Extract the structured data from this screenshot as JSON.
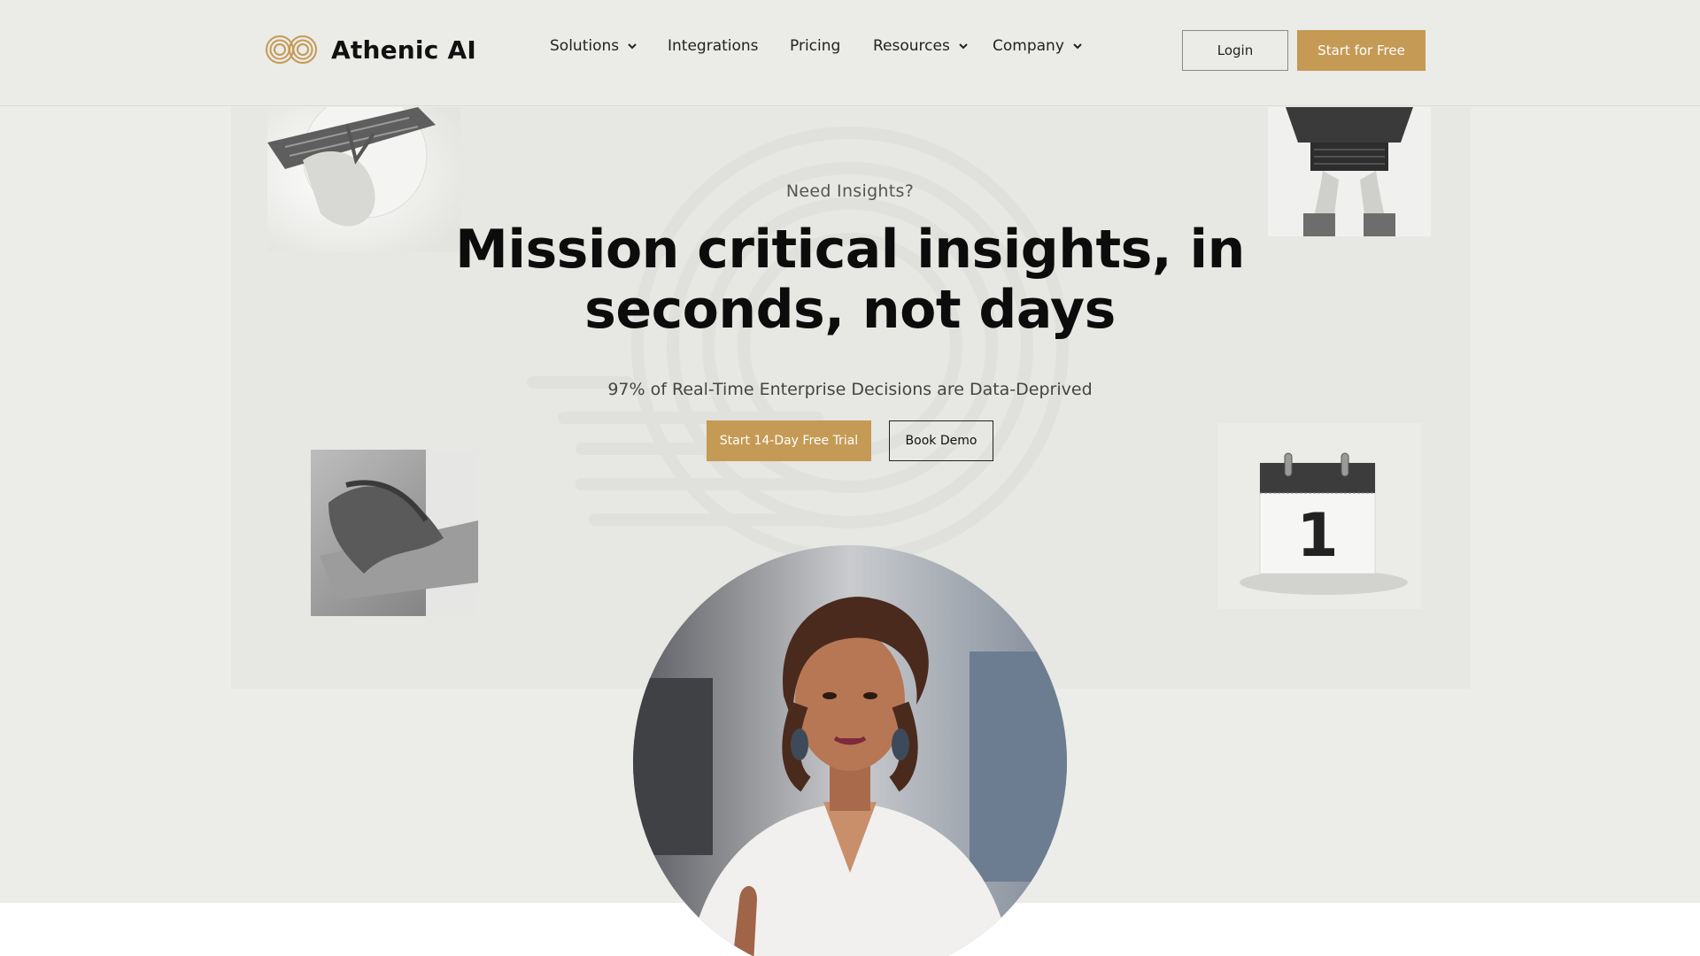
{
  "brand": {
    "name": "Athenic AI",
    "accent": "#c49a55"
  },
  "nav": {
    "items": [
      {
        "label": "Solutions",
        "has_dropdown": true
      },
      {
        "label": "Integrations",
        "has_dropdown": false
      },
      {
        "label": "Pricing",
        "has_dropdown": false
      },
      {
        "label": "Resources",
        "has_dropdown": true
      },
      {
        "label": "Company",
        "has_dropdown": true
      }
    ],
    "login_label": "Login",
    "start_label": "Start for Free"
  },
  "hero": {
    "eyebrow": "Need Insights?",
    "headline_line1": "Mission critical insights, in",
    "headline_line2": "seconds, not days",
    "subheadline": "97% of Real-Time Enterprise Decisions are Data-Deprived",
    "primary_cta": "Start 14-Day Free Trial",
    "secondary_cta": "Book Demo",
    "calendar_day": "1"
  },
  "icons": {
    "logo": "infinity-rings-icon",
    "dropdown": "chevron-down-icon"
  }
}
